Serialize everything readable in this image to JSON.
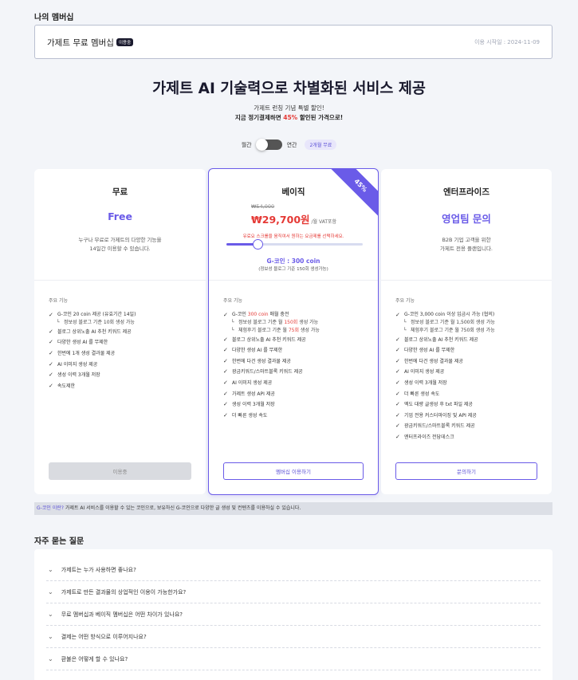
{
  "membership": {
    "section_title": "나의 멤버십",
    "name": "가제트 무료 멤버십",
    "status_badge": "이용중",
    "start_date": "이용 시작일 : 2024-11-09"
  },
  "hero": {
    "title": "가제트 AI 기술력으로 차별화된 서비스 제공",
    "sub1": "가제트 런칭 기념 특별 할인!",
    "sub2_prefix": "지금 정기결제하면 ",
    "sub2_highlight": "45%",
    "sub2_suffix": " 할인된 가격으로!"
  },
  "billing_toggle": {
    "monthly_label": "월간",
    "yearly_label": "연간",
    "discount_pill": "2개월 무료",
    "selected": "monthly"
  },
  "plans": {
    "free": {
      "title": "무료",
      "price": "Free",
      "description": "누구나 무료로 가제트의 다양한 기능을\n14일간 이용할 수 있습니다.",
      "features_label": "주요 기능",
      "features": [
        "G-코인 20 coin 제공 (유효기간 14일)",
        "정보성 블로그 기준 10회 생성 가능",
        "블로그 상위노출 AI 추천 키워드 제공",
        "다양한 생성 AI 를 무제한",
        "한번에 1개 생성 결과물 제공",
        "AI 이미지 생성 제공",
        "생성 이력 3개월 저장",
        "속도제한"
      ],
      "button": "이용중"
    },
    "basic": {
      "title": "베이직",
      "ribbon": "45%",
      "original_price": "₩54,000",
      "price": "₩29,700원",
      "per_month": "/월 VAT포함",
      "slider_note": "유료요 스크롤을 움직여서 원하는 요금제를 선택하세요.",
      "slider_value_fraction": 0.23,
      "coin_label": "G-코인 : 300 coin",
      "coin_note": "(정보성 블로그 기준 150회 생성가능)",
      "features_label": "주요 기능",
      "features": {
        "coin_prefix": "G-코인 ",
        "coin_highlight": "300 coin",
        "coin_suffix": " 매월 충전",
        "sub1_prefix": "정보성 블로그 기준 월 ",
        "sub1_highlight": "150회",
        "sub1_suffix": " 생성 가능",
        "sub2_prefix": "체험후기 블로그 기준 월 ",
        "sub2_highlight": "75회",
        "sub2_suffix": " 생성 가능",
        "items": [
          "블로그 상위노출 AI 추천 키워드 제공",
          "다양한 생성 AI 를 무제한",
          "한번에 다건 생성 결과물 제공",
          "광금키워드/스마트블록 키워드 제공",
          "AI 이미지 생성 제공",
          "가제트 생성 API 제공",
          "생성 이력 3개월 저장",
          "더 빠른 생성 속도"
        ]
      },
      "button": "멤버십 이용하기"
    },
    "enterprise": {
      "title": "엔터프라이즈",
      "price": "영업팀 문의",
      "description": "B2B 기업 고객을 위한\n가제트 전용 플랜입니다.",
      "features_label": "주요 기능",
      "features": [
        "G-코인 3,000 coin 이상 입금시 가능 (협의)",
        "정보성 블로그 기준 월 1,500회 생성 가능",
        "체험후기 블로그 기준 월 750회 생성 가능",
        "블로그 상위노출 AI 추천 키워드 제공",
        "다양한 생성 AI 를 무제한",
        "한번에 다건 생성 결과물 제공",
        "AI 이미지 생성 제공",
        "생성 이력 3개월 저장",
        "더 빠른 생성 속도",
        "엑도 대량 글생성 후 txt 파일 제공",
        "기업 전용 커스터마이징 및 API 제공",
        "광금키워드/스마트블록 키워드 제공",
        "엔터프라이즈 전담데스크"
      ],
      "button": "문의하기"
    }
  },
  "gcoin_info": {
    "link": "G-코인 이란?",
    "text": " 가제트 AI 서비스를 이용할 수 있는 코인으로, 보유하신 G-코인으로 다양한 글 생성 및 컨텐츠를 이용하실 수 있습니다."
  },
  "faq": {
    "title": "자주 묻는 질문",
    "items": [
      "가제트는 누가 사용하면 좋나요?",
      "가제트로 만든 결과물의 상업적인 이용이 가능한가요?",
      "무료 멤버십과 베이직 멤버십은 어떤 차이가 있나요?",
      "결제는 어떤 방식으로 이루어지나요?",
      "환불은 어떻게 할 수 있나요?"
    ]
  },
  "colors": {
    "accent": "#6a5be8",
    "highlight_red": "#e53935",
    "background": "#f3f5f9"
  }
}
